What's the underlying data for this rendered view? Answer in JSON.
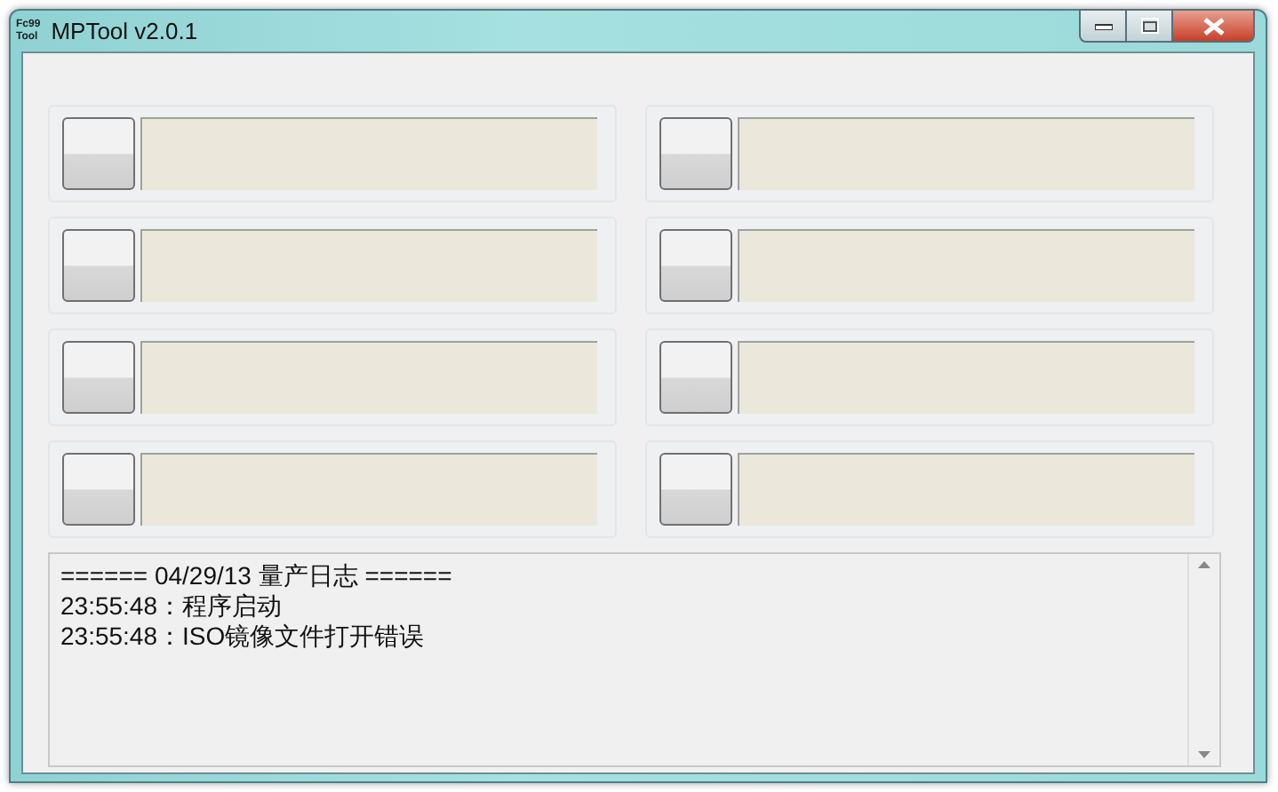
{
  "window": {
    "title": "MPTool v2.0.1",
    "icon_lines": [
      "Fc99",
      "Tool"
    ]
  },
  "ports": [
    {
      "kind": "port"
    },
    {
      "kind": "port"
    },
    {
      "kind": "port"
    },
    {
      "kind": "port"
    },
    {
      "kind": "port"
    },
    {
      "kind": "port"
    },
    {
      "kind": "port"
    },
    {
      "kind": "port"
    }
  ],
  "log": {
    "lines": [
      "====== 04/29/13 量产日志 ======",
      "23:55:48：程序启动",
      "23:55:48：ISO镜像文件打开错误"
    ]
  }
}
